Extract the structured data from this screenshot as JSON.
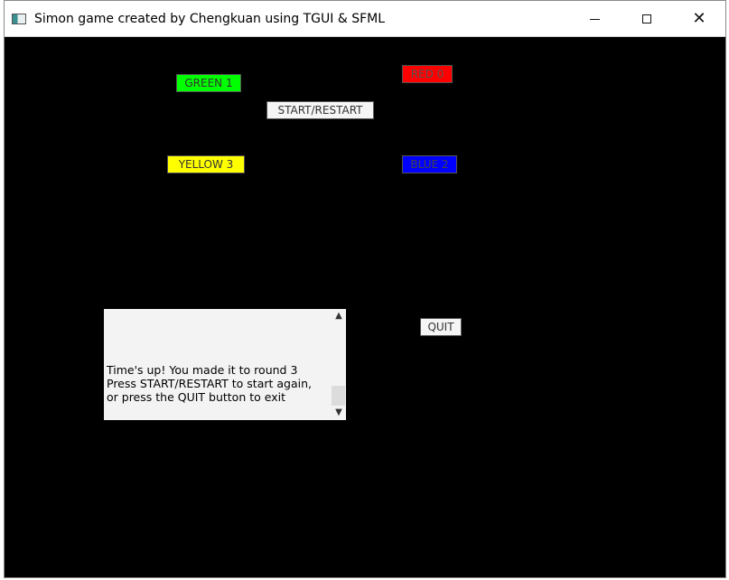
{
  "window": {
    "title": "Simon game created by Chengkuan using TGUI & SFML",
    "icon": "app-window-icon",
    "controls": {
      "minimize_icon": "minimize-icon",
      "maximize_icon": "maximize-icon",
      "close_symbol": "✕"
    }
  },
  "buttons": {
    "green": {
      "label": "GREEN 1",
      "color": "#00ff00"
    },
    "red": {
      "label": "RED 0",
      "color": "#ff0000"
    },
    "start": {
      "label": "START/RESTART",
      "color": "#f5f5f5"
    },
    "yellow": {
      "label": "YELLOW 3",
      "color": "#ffff00"
    },
    "blue": {
      "label": "BLUE 2",
      "color": "#0000ff"
    },
    "quit": {
      "label": "QUIT",
      "color": "#f5f5f5"
    }
  },
  "chatbox": {
    "lines": [
      "Time's up! You made it to round 3",
      "Press START/RESTART to start again,",
      "or press the QUIT button to exit"
    ],
    "scroll_up_symbol": "▲",
    "scroll_down_symbol": "▼"
  },
  "colors": {
    "background": "#000000",
    "chatbox_background": "#f3f3f3"
  }
}
